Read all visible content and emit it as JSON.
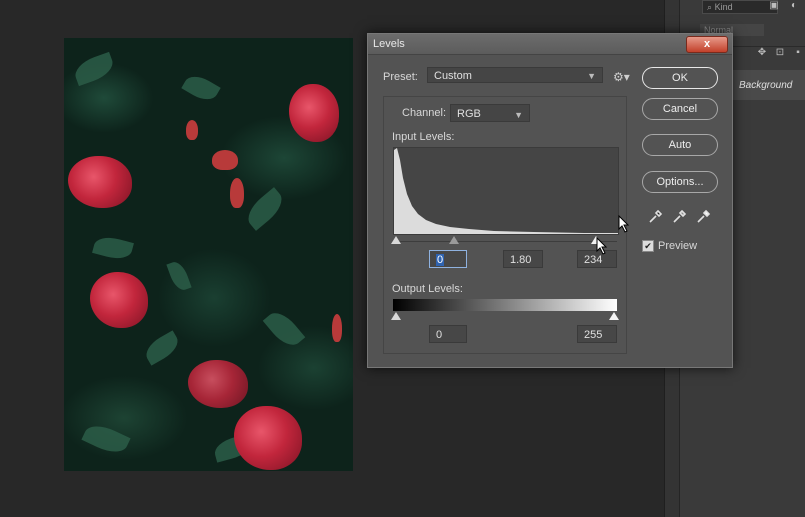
{
  "dialog": {
    "title": "Levels",
    "close_symbol": "x",
    "preset_label": "Preset:",
    "preset_value": "Custom",
    "channel_label": "Channel:",
    "channel_value": "RGB",
    "input_levels_label": "Input Levels:",
    "input_black": "0",
    "input_gamma": "1.80",
    "input_white": "234",
    "output_levels_label": "Output Levels:",
    "output_black": "0",
    "output_white": "255",
    "buttons": {
      "ok": "OK",
      "cancel": "Cancel",
      "auto": "Auto",
      "options": "Options..."
    },
    "preview_label": "Preview",
    "preview_checked": true
  },
  "layers_panel": {
    "kind_placeholder": "Kind",
    "blend_mode": "Normal",
    "background_layer": "Background"
  },
  "icons": [
    "gear-icon",
    "close-icon",
    "eyedropper-black-icon",
    "eyedropper-gray-icon",
    "eyedropper-white-icon",
    "checkbox-check-icon",
    "search-icon",
    "mouse-cursor-icon"
  ]
}
